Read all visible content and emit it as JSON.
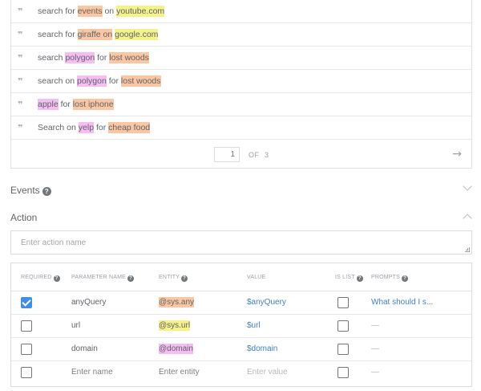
{
  "training_phrases": [
    {
      "parts": [
        {
          "t": "search for "
        },
        {
          "t": "events",
          "hl": "orange"
        },
        {
          "t": " on "
        },
        {
          "t": "youtube.com",
          "hl": "yellow"
        }
      ]
    },
    {
      "parts": [
        {
          "t": "search for "
        },
        {
          "t": "giraffe on",
          "hl": "orange"
        },
        {
          "t": " "
        },
        {
          "t": "google.com",
          "hl": "yellow"
        }
      ]
    },
    {
      "parts": [
        {
          "t": "search "
        },
        {
          "t": "polygon",
          "hl": "pink"
        },
        {
          "t": " for "
        },
        {
          "t": "lost woods",
          "hl": "orange"
        }
      ]
    },
    {
      "parts": [
        {
          "t": "search on "
        },
        {
          "t": "polygon",
          "hl": "pink"
        },
        {
          "t": " for "
        },
        {
          "t": "lost woods",
          "hl": "orange"
        }
      ]
    },
    {
      "parts": [
        {
          "t": "apple",
          "hl": "pink"
        },
        {
          "t": " for "
        },
        {
          "t": "lost iphone",
          "hl": "orange"
        }
      ]
    },
    {
      "parts": [
        {
          "t": "Search on "
        },
        {
          "t": "yelp",
          "hl": "pink"
        },
        {
          "t": " for "
        },
        {
          "t": "cheap food",
          "hl": "orange"
        }
      ]
    }
  ],
  "pagination": {
    "current_page": "1",
    "of_label": "OF",
    "total_pages": "3",
    "next_icon": "arrow-right-icon"
  },
  "events_section": {
    "title": "Events",
    "icon": "help-icon",
    "expanded": false
  },
  "action_section": {
    "title": "Action",
    "expanded": true,
    "input_placeholder": "Enter action name"
  },
  "parameters": {
    "headers": {
      "required": "REQUIRED",
      "name": "PARAMETER NAME",
      "entity": "ENTITY",
      "value": "VALUE",
      "is_list": "IS LIST",
      "prompts": "PROMPTS"
    },
    "rows": [
      {
        "required": true,
        "name": "anyQuery",
        "entity": "@sys.any",
        "entity_hl": "orange",
        "value": "$anyQuery",
        "is_list": false,
        "prompts": "What should I s..."
      },
      {
        "required": false,
        "name": "url",
        "entity": "@sys.url",
        "entity_hl": "yellow",
        "value": "$url",
        "is_list": false,
        "prompts": "—"
      },
      {
        "required": false,
        "name": "domain",
        "entity": "@domain",
        "entity_hl": "pink",
        "value": "$domain",
        "is_list": false,
        "prompts": "—"
      }
    ],
    "new_row": {
      "name_placeholder": "Enter name",
      "entity_placeholder": "Enter entity",
      "value_placeholder": "Enter value",
      "prompts": "—"
    }
  },
  "colors": {
    "orange_highlight": "#fbc7a3",
    "yellow_highlight": "#f6f28a",
    "pink_highlight": "#f6bdf3",
    "link_blue": "#3f7fc4",
    "checkbox_blue": "#3f8ee8"
  }
}
